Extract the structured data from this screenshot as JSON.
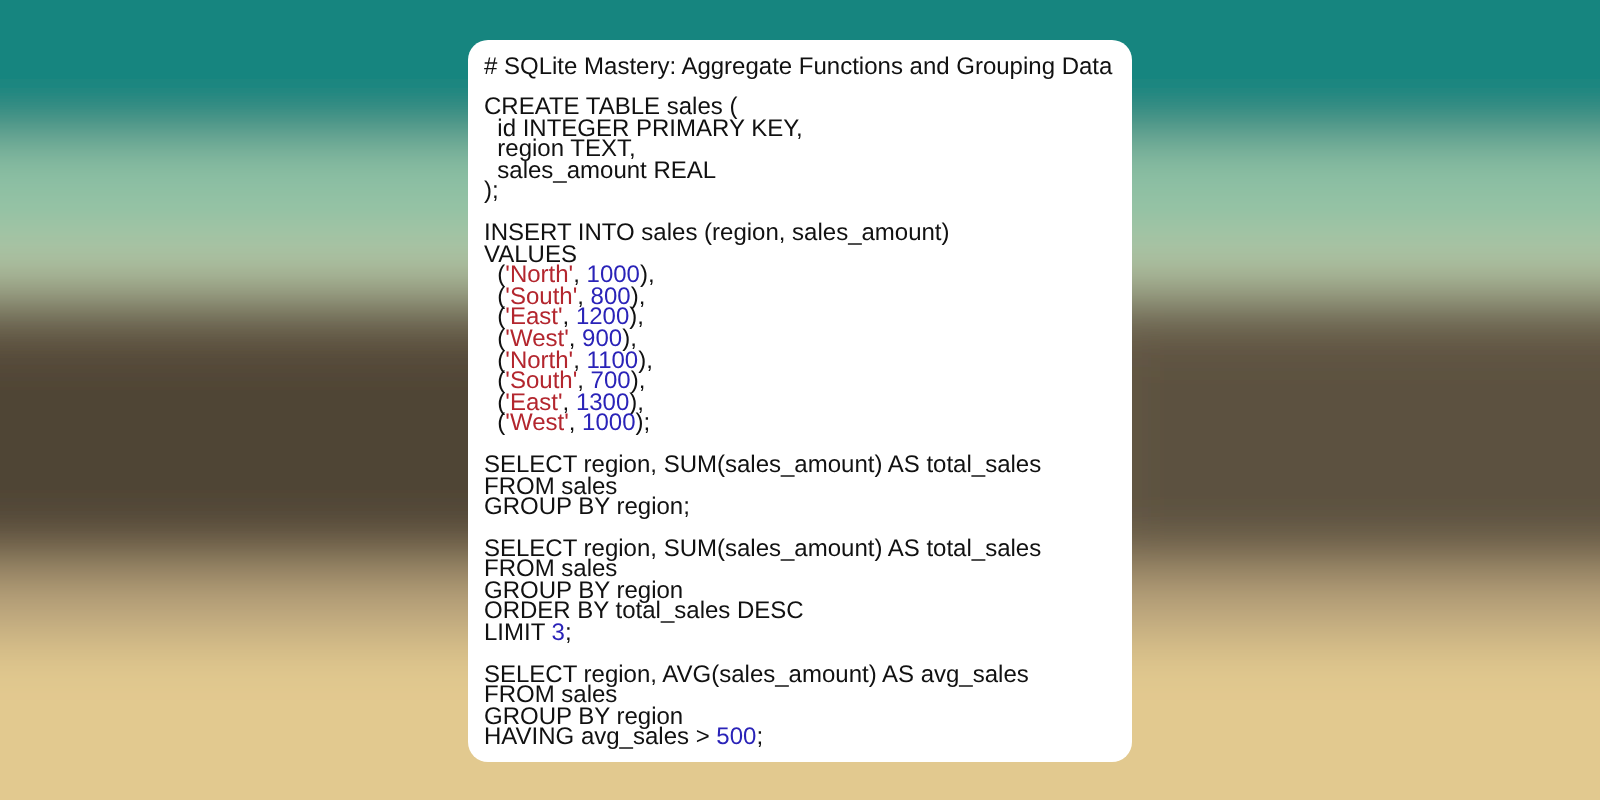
{
  "card": {
    "title": "# SQLite Mastery: Aggregate Functions and Grouping Data",
    "blocks": [
      {
        "lines": [
          [
            {
              "kind": "plain",
              "text": "CREATE TABLE sales ("
            }
          ],
          [
            {
              "kind": "plain",
              "text": "  id INTEGER PRIMARY KEY,"
            }
          ],
          [
            {
              "kind": "plain",
              "text": "  region TEXT,"
            }
          ],
          [
            {
              "kind": "plain",
              "text": "  sales_amount REAL"
            }
          ],
          [
            {
              "kind": "plain",
              "text": ");"
            }
          ]
        ]
      },
      {
        "lines": [
          [
            {
              "kind": "plain",
              "text": "INSERT INTO sales (region, sales_amount)"
            }
          ],
          [
            {
              "kind": "plain",
              "text": "VALUES"
            }
          ],
          [
            {
              "kind": "plain",
              "text": "  ("
            },
            {
              "kind": "string",
              "text": "'North'"
            },
            {
              "kind": "plain",
              "text": ", "
            },
            {
              "kind": "number",
              "text": "1000"
            },
            {
              "kind": "plain",
              "text": "),"
            }
          ],
          [
            {
              "kind": "plain",
              "text": "  ("
            },
            {
              "kind": "string",
              "text": "'South'"
            },
            {
              "kind": "plain",
              "text": ", "
            },
            {
              "kind": "number",
              "text": "800"
            },
            {
              "kind": "plain",
              "text": "),"
            }
          ],
          [
            {
              "kind": "plain",
              "text": "  ("
            },
            {
              "kind": "string",
              "text": "'East'"
            },
            {
              "kind": "plain",
              "text": ", "
            },
            {
              "kind": "number",
              "text": "1200"
            },
            {
              "kind": "plain",
              "text": "),"
            }
          ],
          [
            {
              "kind": "plain",
              "text": "  ("
            },
            {
              "kind": "string",
              "text": "'West'"
            },
            {
              "kind": "plain",
              "text": ", "
            },
            {
              "kind": "number",
              "text": "900"
            },
            {
              "kind": "plain",
              "text": "),"
            }
          ],
          [
            {
              "kind": "plain",
              "text": "  ("
            },
            {
              "kind": "string",
              "text": "'North'"
            },
            {
              "kind": "plain",
              "text": ", "
            },
            {
              "kind": "number",
              "text": "1100"
            },
            {
              "kind": "plain",
              "text": "),"
            }
          ],
          [
            {
              "kind": "plain",
              "text": "  ("
            },
            {
              "kind": "string",
              "text": "'South'"
            },
            {
              "kind": "plain",
              "text": ", "
            },
            {
              "kind": "number",
              "text": "700"
            },
            {
              "kind": "plain",
              "text": "),"
            }
          ],
          [
            {
              "kind": "plain",
              "text": "  ("
            },
            {
              "kind": "string",
              "text": "'East'"
            },
            {
              "kind": "plain",
              "text": ", "
            },
            {
              "kind": "number",
              "text": "1300"
            },
            {
              "kind": "plain",
              "text": "),"
            }
          ],
          [
            {
              "kind": "plain",
              "text": "  ("
            },
            {
              "kind": "string",
              "text": "'West'"
            },
            {
              "kind": "plain",
              "text": ", "
            },
            {
              "kind": "number",
              "text": "1000"
            },
            {
              "kind": "plain",
              "text": ");"
            }
          ]
        ]
      },
      {
        "lines": [
          [
            {
              "kind": "plain",
              "text": "SELECT region, SUM(sales_amount) AS total_sales"
            }
          ],
          [
            {
              "kind": "plain",
              "text": "FROM sales"
            }
          ],
          [
            {
              "kind": "plain",
              "text": "GROUP BY region;"
            }
          ]
        ]
      },
      {
        "lines": [
          [
            {
              "kind": "plain",
              "text": "SELECT region, SUM(sales_amount) AS total_sales"
            }
          ],
          [
            {
              "kind": "plain",
              "text": "FROM sales"
            }
          ],
          [
            {
              "kind": "plain",
              "text": "GROUP BY region"
            }
          ],
          [
            {
              "kind": "plain",
              "text": "ORDER BY total_sales DESC"
            }
          ],
          [
            {
              "kind": "plain",
              "text": "LIMIT "
            },
            {
              "kind": "number",
              "text": "3"
            },
            {
              "kind": "plain",
              "text": ";"
            }
          ]
        ]
      },
      {
        "lines": [
          [
            {
              "kind": "plain",
              "text": "SELECT region, AVG(sales_amount) AS avg_sales"
            }
          ],
          [
            {
              "kind": "plain",
              "text": "FROM sales"
            }
          ],
          [
            {
              "kind": "plain",
              "text": "GROUP BY region"
            }
          ],
          [
            {
              "kind": "plain",
              "text": "HAVING avg_sales > "
            },
            {
              "kind": "number",
              "text": "500"
            },
            {
              "kind": "plain",
              "text": ";"
            }
          ]
        ]
      }
    ]
  }
}
